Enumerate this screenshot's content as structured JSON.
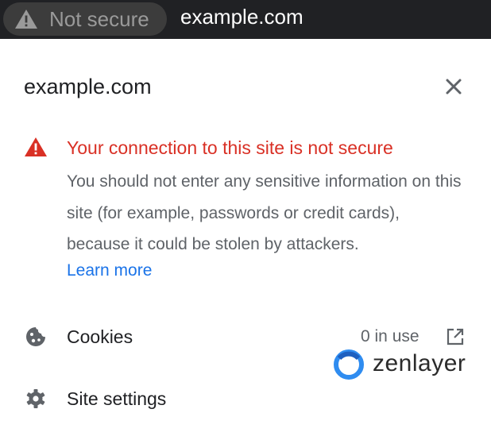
{
  "address_bar": {
    "security_chip": {
      "icon": "warning-triangle-icon",
      "label": "Not secure"
    },
    "url": "example.com"
  },
  "site_info_panel": {
    "title": "example.com",
    "close_icon": "close-icon",
    "warning": {
      "icon": "warning-triangle-icon",
      "color": "#d93025",
      "title": "Your connection to this site is not secure",
      "body": "You should not enter any sensitive information on this site (for example, passwords or credit cards), because it could be stolen by attackers.",
      "link_label": "Learn more",
      "link_color": "#1a73e8"
    },
    "rows": [
      {
        "icon": "cookie-icon",
        "label": "Cookies",
        "value": "0 in use",
        "trailing_icon": "external-link-icon"
      },
      {
        "icon": "gear-icon",
        "label": "Site settings"
      }
    ]
  },
  "watermark": {
    "icon": "zenlayer-logo-icon",
    "text": "zenlayer",
    "accent_color": "#2f8cf0"
  }
}
